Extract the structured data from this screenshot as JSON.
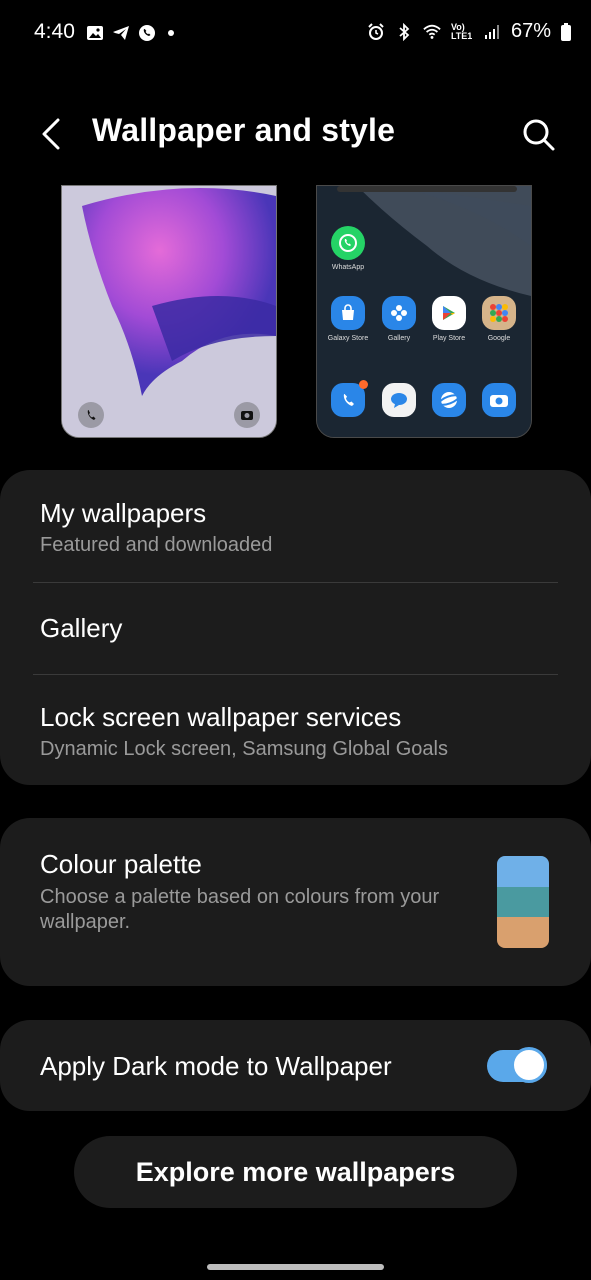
{
  "status_bar": {
    "time": "4:40",
    "battery_percent": "67%",
    "network_label": "Vo) LTE1"
  },
  "header": {
    "title": "Wallpaper and style"
  },
  "home_preview": {
    "apps": [
      {
        "label": "WhatsApp",
        "icon": "whatsapp-icon",
        "color": "#25d366"
      },
      {
        "label": "Galaxy Store",
        "icon": "galaxy-store-icon",
        "color": "#1e88e5"
      },
      {
        "label": "Gallery",
        "icon": "gallery-icon",
        "color": "#1e88e5"
      },
      {
        "label": "Play Store",
        "icon": "play-store-icon",
        "color": "#ffffff"
      },
      {
        "label": "Google",
        "icon": "google-folder-icon",
        "color": "#d6b48a"
      }
    ]
  },
  "menu": {
    "my_wallpapers": {
      "title": "My wallpapers",
      "subtitle": "Featured and downloaded"
    },
    "gallery": {
      "title": "Gallery"
    },
    "lock_services": {
      "title": "Lock screen wallpaper services",
      "subtitle": "Dynamic Lock screen, Samsung Global Goals"
    }
  },
  "colour_palette": {
    "title": "Colour palette",
    "subtitle_line1": "Choose a palette based on colours from your",
    "subtitle_line2": "wallpaper.",
    "swatches": [
      "#6fb0e8",
      "#4a9aa0",
      "#d9a06e"
    ]
  },
  "dark_mode": {
    "label": "Apply Dark mode to Wallpaper",
    "enabled": true
  },
  "explore_button": {
    "label": "Explore more wallpapers"
  },
  "colors": {
    "background": "#000000",
    "card": "#1c1c1c",
    "accent": "#5aa8ea",
    "subtext": "#9a9a9a"
  }
}
